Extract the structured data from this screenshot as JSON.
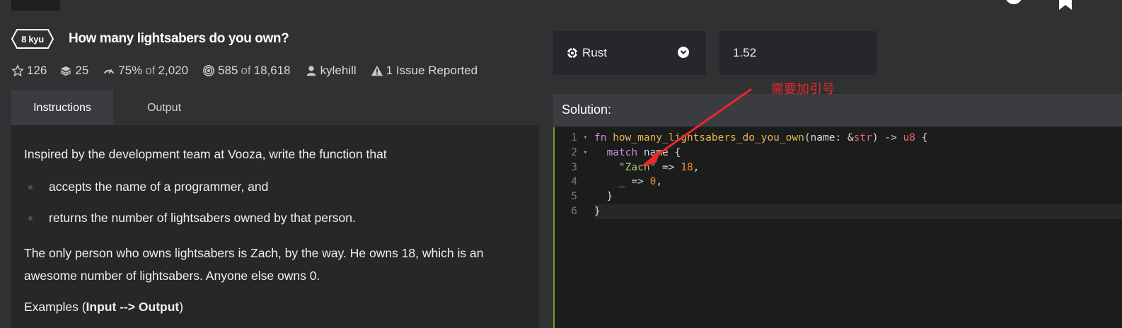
{
  "kata": {
    "rank": "8 kyu",
    "title": "How many lightsabers do you own?"
  },
  "meta": {
    "stars": "126",
    "collections": "25",
    "satisfaction_pct": "75%",
    "satisfaction_of": "of",
    "satisfaction_votes": "2,020",
    "completed": "585",
    "completed_of": "of",
    "completed_total": "18,618",
    "author": "kylehill",
    "issues": "1 Issue Reported"
  },
  "tabs": [
    {
      "label": "Instructions",
      "active": true
    },
    {
      "label": "Output",
      "active": false
    }
  ],
  "description": {
    "intro": "Inspired by the development team at Vooza, write the function that",
    "bullets": [
      "accepts the name of a programmer, and",
      "returns the number of lightsabers owned by that person."
    ],
    "paragraph": "The only person who owns lightsabers is Zach, by the way. He owns 18, which is an awesome number of lightsabers. Anyone else owns 0.",
    "examples_prefix": "Examples (",
    "examples_bold": "Input --> Output",
    "examples_suffix": ")"
  },
  "language": {
    "selected": "Rust"
  },
  "version": {
    "selected": "1.52"
  },
  "solution": {
    "label": "Solution:"
  },
  "editor": {
    "line_numbers": [
      "1",
      "2",
      "3",
      "4",
      "5",
      "6"
    ],
    "lines": [
      [
        {
          "t": "fn",
          "c": "kw"
        },
        {
          "t": " ",
          "c": "plain"
        },
        {
          "t": "how_many_lightsabers_do_you_own",
          "c": "fnname"
        },
        {
          "t": "(name: &",
          "c": "plain"
        },
        {
          "t": "str",
          "c": "ty"
        },
        {
          "t": ") -> ",
          "c": "plain"
        },
        {
          "t": "u8",
          "c": "ty"
        },
        {
          "t": " {",
          "c": "plain"
        }
      ],
      [
        {
          "t": "  ",
          "c": "plain"
        },
        {
          "t": "match",
          "c": "kw"
        },
        {
          "t": " name {",
          "c": "plain"
        }
      ],
      [
        {
          "t": "    ",
          "c": "plain"
        },
        {
          "t": "\"Zach\"",
          "c": "str"
        },
        {
          "t": " => ",
          "c": "plain"
        },
        {
          "t": "18",
          "c": "num-lit"
        },
        {
          "t": ",",
          "c": "plain"
        }
      ],
      [
        {
          "t": "    _ => ",
          "c": "plain"
        },
        {
          "t": "0",
          "c": "num-lit"
        },
        {
          "t": ",",
          "c": "plain"
        }
      ],
      [
        {
          "t": "  }",
          "c": "plain"
        }
      ],
      [
        {
          "t": "}",
          "c": "plain"
        }
      ]
    ]
  },
  "annotation": {
    "text": "需要加引号",
    "color": "#e8282a"
  },
  "colors": {
    "background": "#303133",
    "panel": "#262729",
    "editor_bg": "#1b1c1c",
    "editor_border": "#7a9a2e"
  }
}
